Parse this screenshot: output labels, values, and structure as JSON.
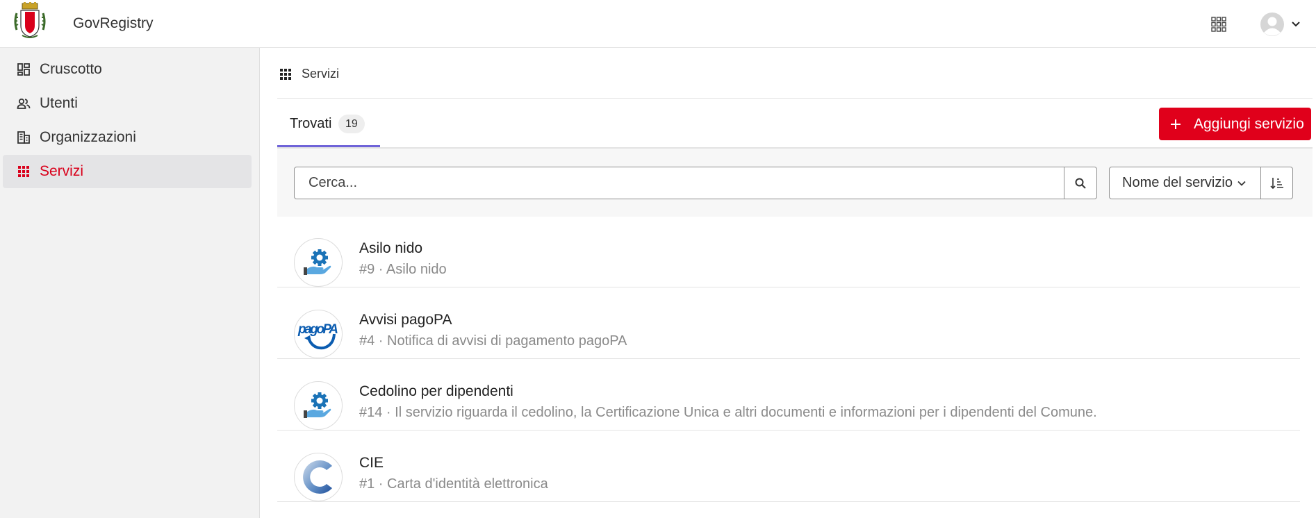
{
  "header": {
    "app_title": "GovRegistry",
    "icons": [
      "coat-of-arms-logo",
      "apps-grid-icon",
      "user-avatar-icon",
      "chevron-down-icon"
    ]
  },
  "sidebar": {
    "items": [
      {
        "label": "Cruscotto",
        "icon": "dashboard-icon"
      },
      {
        "label": "Utenti",
        "icon": "users-icon"
      },
      {
        "label": "Organizzazioni",
        "icon": "organization-icon"
      },
      {
        "label": "Servizi",
        "icon": "grid-icon",
        "active": true
      }
    ],
    "active_color": "#d9001b"
  },
  "main": {
    "breadcrumb": "Servizi",
    "tabs": [
      {
        "label": "Trovati",
        "count": "19"
      }
    ],
    "add_button_label": "Aggiungi servizio",
    "search": {
      "placeholder": "Cerca..."
    },
    "sort": {
      "selected": "Nome del servizio"
    },
    "services": [
      {
        "name": "Asilo nido",
        "desc": "#9 · Asilo nido",
        "icon": "service-gear-hand-icon"
      },
      {
        "name": "Avvisi pagoPA",
        "desc": "#4 · Notifica di avvisi di pagamento pagoPA",
        "icon": "pagopa-logo"
      },
      {
        "name": "Cedolino per dipendenti",
        "desc": "#14 · Il servizio riguarda il cedolino, la Certificazione Unica e altri documenti e informazioni per i dipendenti del Comune.",
        "icon": "service-gear-hand-icon"
      },
      {
        "name": "CIE",
        "desc": "#1 · Carta d'identità elettronica",
        "icon": "cie-logo"
      }
    ]
  },
  "colors": {
    "accent": "#e0001b",
    "tab_indicator": "#6f63d8"
  }
}
